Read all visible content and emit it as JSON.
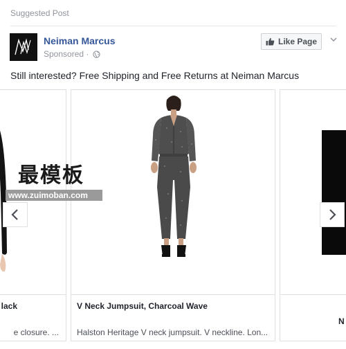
{
  "header": {
    "suggested_label": "Suggested Post"
  },
  "advertiser": {
    "name": "Neiman Marcus",
    "sponsored_label": "Sponsored",
    "separator": "·",
    "logo_icon": "neiman-marcus-logo",
    "like_button_label": "Like Page",
    "like_icon": "thumbs-up-icon",
    "menu_icon": "chevron-down-icon"
  },
  "post": {
    "message": "Still interested? Free Shipping and Free Returns at Neiman Marcus"
  },
  "carousel": {
    "cards": [
      {
        "title": "lack",
        "description": "e closure. ..."
      },
      {
        "title": "V Neck Jumpsuit, Charcoal Wave",
        "description": "Halston Heritage V neck jumpsuit. V neckline. Lon..."
      },
      {
        "title": "N",
        "description": ""
      }
    ],
    "prev_icon": "chevron-left-icon",
    "next_icon": "chevron-right-icon"
  },
  "watermark": {
    "text": "最模板",
    "url": "www.zuimoban.com"
  },
  "colors": {
    "link_blue": "#365899",
    "meta_gray": "#90949c",
    "border": "#dddfe2"
  }
}
